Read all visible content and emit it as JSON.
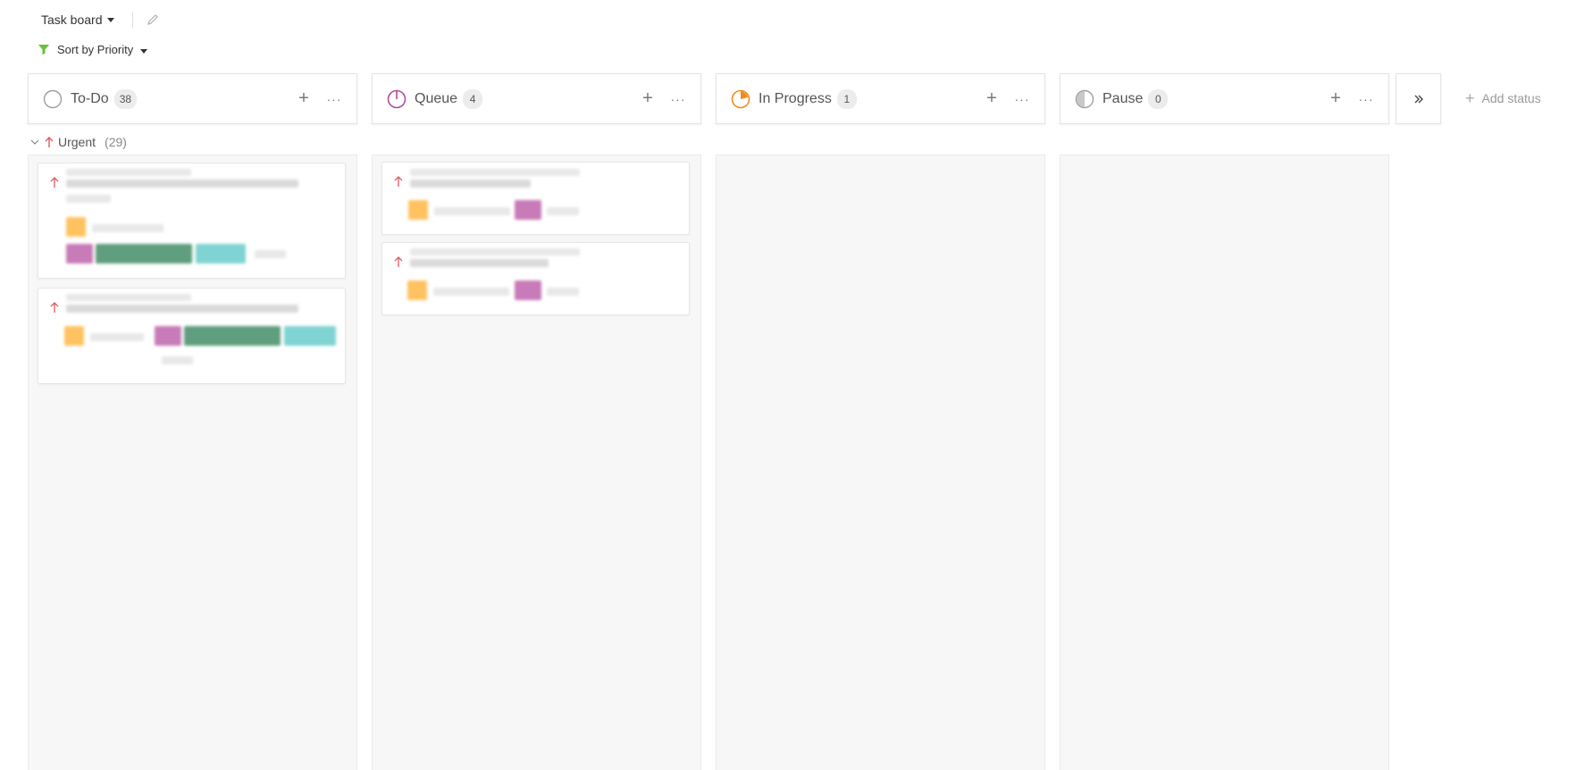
{
  "toolbar": {
    "view_label": "Task board",
    "sort_label": "Sort by Priority"
  },
  "columns": [
    {
      "title": "To-Do",
      "count": "38",
      "status_color": "#9e9e9e"
    },
    {
      "title": "Queue",
      "count": "4",
      "status_color": "#b04c9c"
    },
    {
      "title": "In Progress",
      "count": "1",
      "status_color": "#f28b1b"
    },
    {
      "title": "Pause",
      "count": "0",
      "status_color": "#9e9e9e"
    }
  ],
  "add_status_label": "Add status",
  "group": {
    "label": "Urgent",
    "count": "(29)",
    "color": "#e05a5a"
  },
  "colors": {
    "filter_icon": "#6bbf3a",
    "chip_orange": "#ffc261",
    "chip_purple": "#c87bb8",
    "chip_green": "#5f9e7e",
    "chip_teal": "#7fd3d3"
  }
}
